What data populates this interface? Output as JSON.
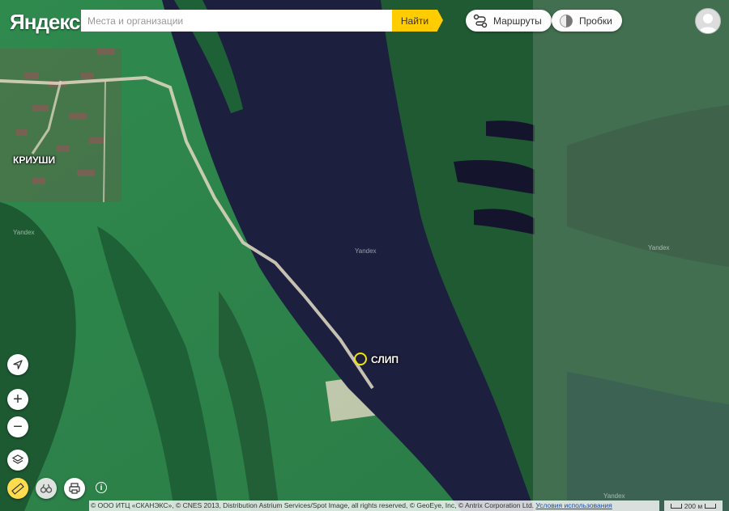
{
  "header": {
    "logo": "Яндекс",
    "search_placeholder": "Места и организации",
    "search_button": "Найти",
    "routes_label": "Маршруты",
    "traffic_label": "Пробки"
  },
  "map": {
    "labels": {
      "village": "КРИУШИ",
      "slip": "СЛИП"
    },
    "watermark": "Yandex",
    "colors": {
      "river": "#1d1f3e",
      "meadow": "#2f8a4e",
      "road": "#d9d3bd"
    }
  },
  "controls": {
    "locate_icon": "arrow-locate-icon",
    "zoom_in": "+",
    "zoom_out": "−",
    "layers_icon": "layers-icon",
    "ruler_icon": "ruler-icon",
    "panorama_icon": "binoculars-icon",
    "print_icon": "printer-icon",
    "info_icon": "info-icon"
  },
  "footer": {
    "copyright": "© ООО ИТЦ «СКАНЭКС», © CNES 2013, Distribution Astrium Services/Spot Image, all rights reserved, © GeoEye, Inc, © Antrix Corporation Ltd.",
    "terms_link": "Условия использования",
    "scale": "200 м"
  }
}
